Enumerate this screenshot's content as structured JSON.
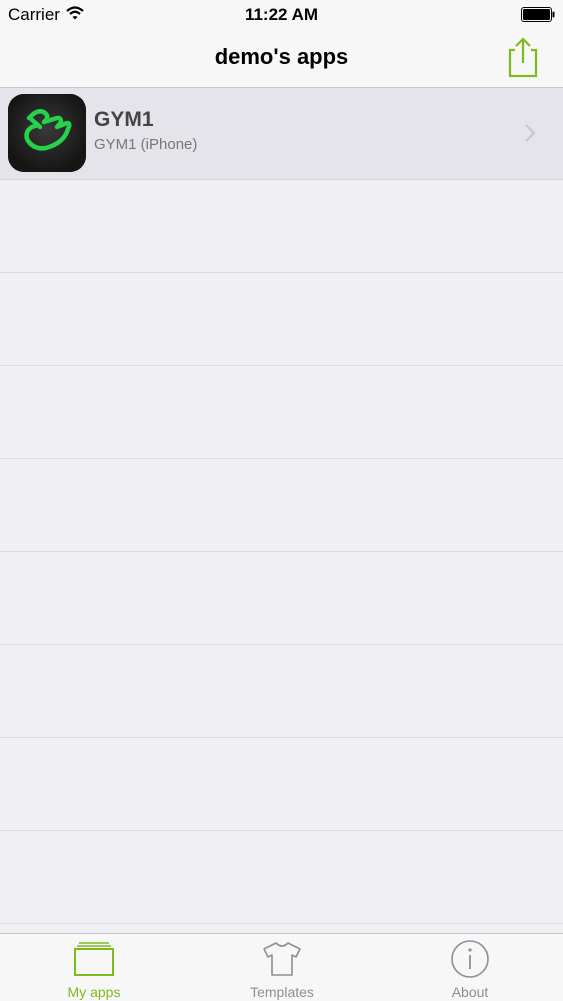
{
  "status_bar": {
    "carrier": "Carrier",
    "time": "11:22 AM"
  },
  "nav": {
    "title": "demo's apps",
    "share_icon": "share-icon"
  },
  "apps": [
    {
      "name": "GYM1",
      "subtitle": "GYM1 (iPhone)",
      "icon": "gym-app-icon"
    }
  ],
  "tabs": [
    {
      "label": "My apps",
      "icon": "my-apps-icon",
      "active": true
    },
    {
      "label": "Templates",
      "icon": "tshirt-icon",
      "active": false
    },
    {
      "label": "About",
      "icon": "info-icon",
      "active": false
    }
  ],
  "colors": {
    "accent": "#7dbb1e",
    "background": "#efeff4",
    "bar": "#f7f7f7",
    "inactive_tab": "#8e8e93"
  }
}
